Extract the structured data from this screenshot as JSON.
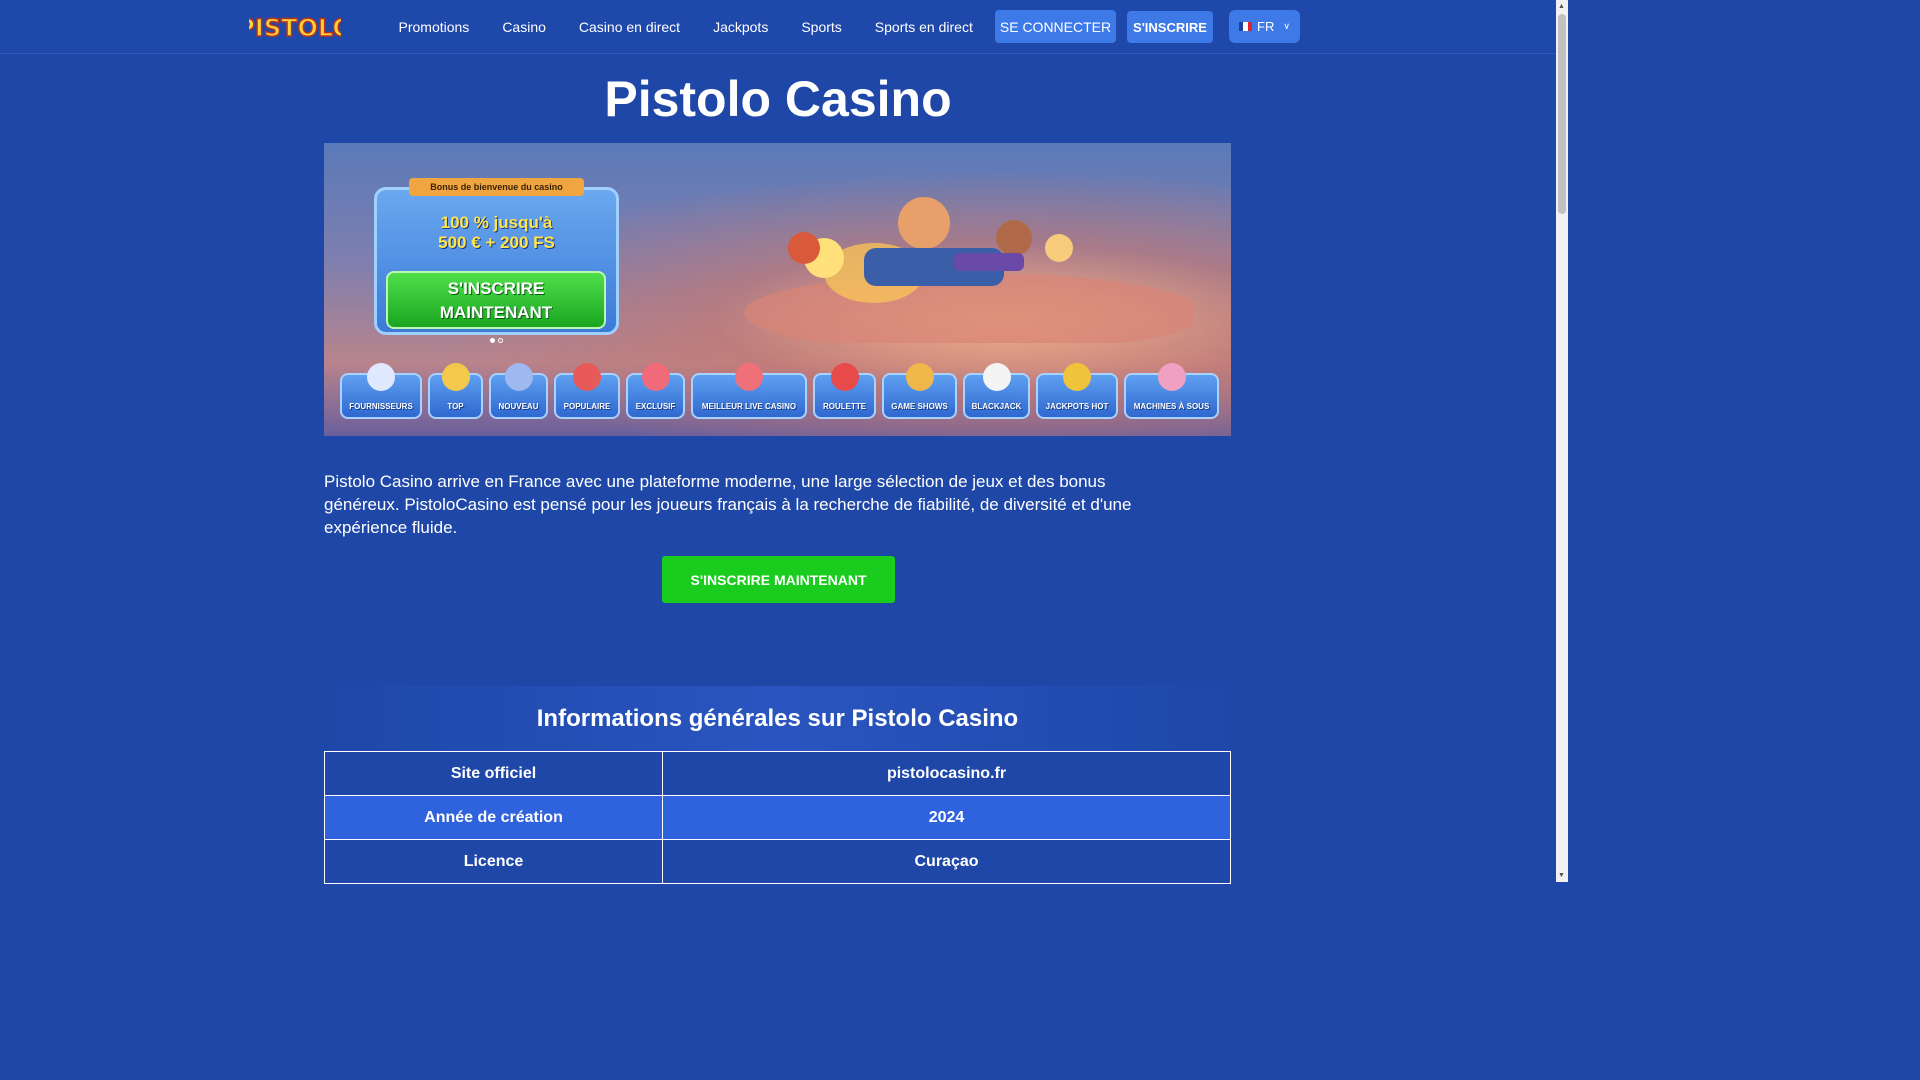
{
  "header": {
    "logo_text": "PISTOLO",
    "nav": [
      "Promotions",
      "Casino",
      "Casino en direct",
      "Jackpots",
      "Sports",
      "Sports en direct"
    ],
    "login_label": "SE CONNECTER",
    "signup_label": "S'INSCRIRE",
    "language": "FR"
  },
  "page_title": "Pistolo Casino",
  "banner": {
    "tag": "Bonus de bienvenue du casino",
    "promo_line1": "100 % jusqu'à",
    "promo_line2": "500 € + 200 FS",
    "cta_line1": "S'INSCRIRE",
    "cta_line2": "MAINTENANT",
    "categories": [
      "FOURNISSEURS",
      "TOP",
      "NOUVEAU",
      "POPULAIRE",
      "EXCLUSIF",
      "MEILLEUR LIVE CASINO",
      "ROULETTE",
      "GAME SHOWS",
      "BLACKJACK",
      "JACKPOTS HOT",
      "MACHINES À SOUS"
    ]
  },
  "intro": "Pistolo Casino arrive en France avec une plateforme moderne, une large sélection de jeux et des bonus généreux. PistoloCasino est pensé pour les joueurs français à la recherche de fiabilité, de diversité et d'une expérience fluide.",
  "cta_label": "S'INSCRIRE MAINTENANT",
  "info": {
    "title": "Informations générales sur Pistolo Casino",
    "rows": [
      {
        "label": "Site officiel",
        "value": "pistolocasino.fr"
      },
      {
        "label": "Année de création",
        "value": "2024"
      },
      {
        "label": "Licence",
        "value": "Curaçao"
      }
    ]
  },
  "colors": {
    "background": "#1e47a8",
    "button": "#3d7ae8",
    "cta": "#19cc1d",
    "row_highlight": "#2f63dd"
  }
}
